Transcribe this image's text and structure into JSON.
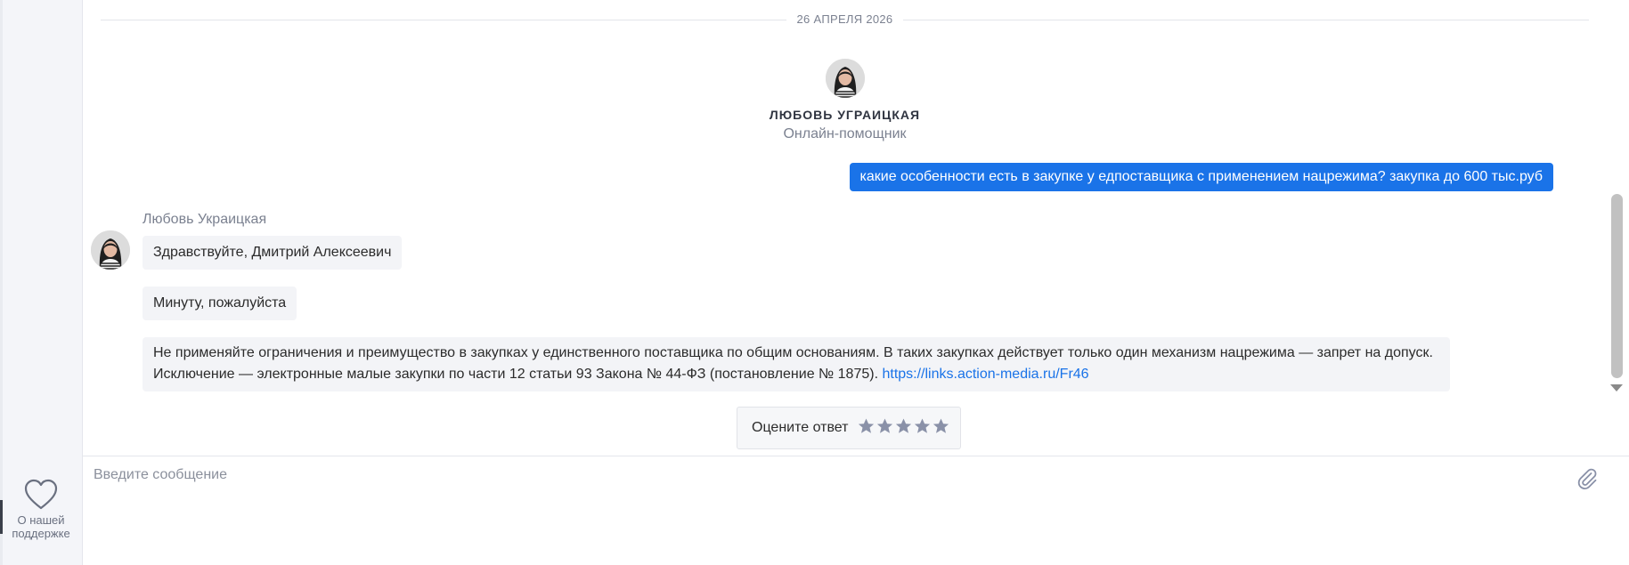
{
  "sidebar": {
    "support_label": "О нашей\nподдержке",
    "support_icon": "heart-icon"
  },
  "chat": {
    "date_separator": "26 АПРЕЛЯ 2026",
    "operator": {
      "name": "ЛЮБОВЬ УГРАИЦКАЯ",
      "role": "Онлайн-помощник",
      "avatar_icon": "avatar"
    },
    "messages_out": [
      {
        "text": "какие особенности есть в закупке у едпоставщика с применением нацрежима? закупка до 600 тыс.руб"
      }
    ],
    "incoming": {
      "sender": "Любовь Украицкая",
      "messages": [
        {
          "text": "Здравствуйте, Дмитрий Алексеевич"
        },
        {
          "text": "Минуту, пожалуйста"
        },
        {
          "text": "Не применяйте ограничения и преимущество в закупках у единственного поставщика по общим основаниям. В таких закупках действует только один механизм нацрежима — запрет на допуск. Исключение — электронные малые закупки по части 12 статьи 93 Закона № 44-ФЗ (постановление № 1875).",
          "link": "https://links.action-media.ru/Fr46"
        }
      ]
    },
    "rating": {
      "label": "Оцените ответ",
      "max_stars": 5,
      "selected": 0,
      "star_color": "#8a91a8"
    }
  },
  "composer": {
    "placeholder": "Введите сообщение",
    "value": "",
    "attach_icon": "paperclip-icon"
  },
  "colors": {
    "accent": "#1a73e8",
    "bubble_in": "#f3f4f7",
    "sidebar_bg": "#f4f5f9"
  }
}
